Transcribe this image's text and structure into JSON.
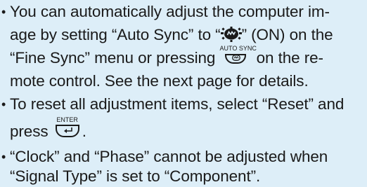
{
  "paragraphs": {
    "p1": {
      "l1a": "You can automatically adjust the computer im-",
      "l2a": "age by setting “Auto Sync” to “",
      "l2b": "” (ON) on the",
      "l3a": "“Fine Sync” menu or pressing",
      "l3b": "on the re-",
      "l4": "mote control. See the next page for details."
    },
    "p2": {
      "l1": "To reset all adjustment items, select “Reset” and",
      "l2a": "press",
      "l2b": "."
    },
    "p3": {
      "l1": "“Clock” and “Phase” cannot be adjusted when",
      "l2": "“Signal Type” is set to “Component”."
    }
  },
  "buttons": {
    "auto_sync_label": "AUTO SYNC",
    "enter_label": "ENTER"
  },
  "icons": {
    "on_indicator": "auto-sync-on-icon",
    "auto_sync_key": "auto-sync-key-icon",
    "enter_key": "enter-key-icon"
  },
  "colors": {
    "background": "#ddeef8",
    "text": "#1a1a1a"
  }
}
